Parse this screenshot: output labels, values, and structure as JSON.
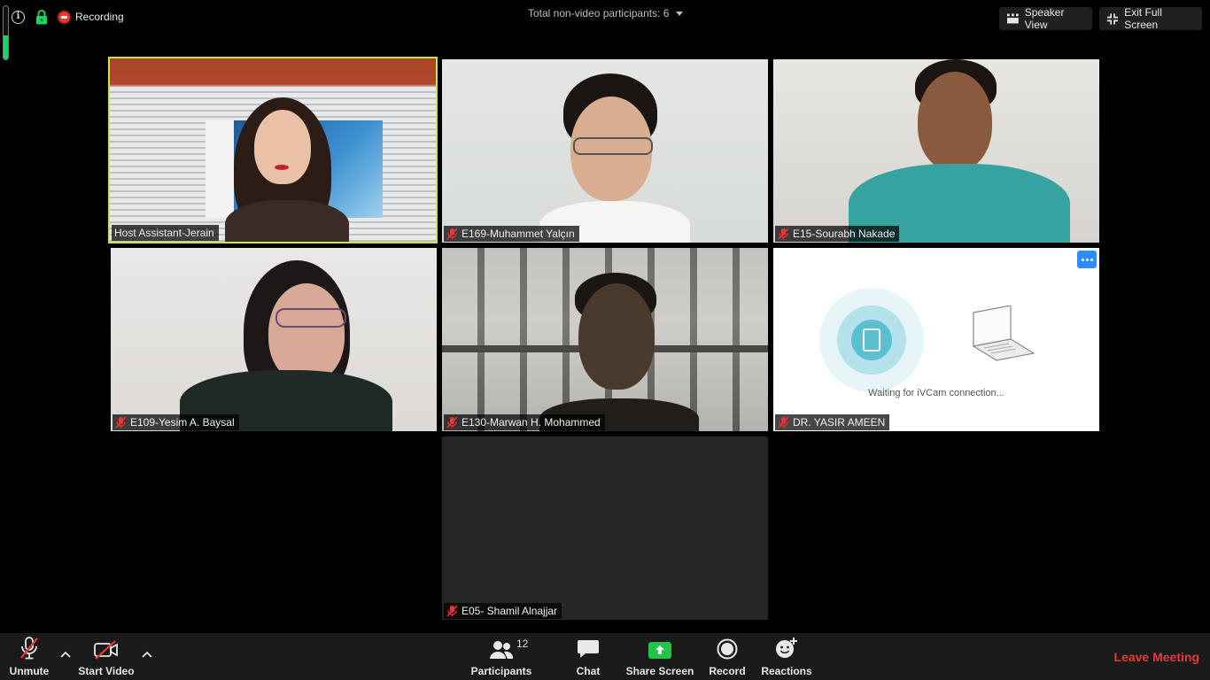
{
  "top_bar": {
    "recording_label": "Recording",
    "nonvideo_label": "Total non-video participants: 6",
    "speaker_view_label": "Speaker View",
    "exit_fullscreen_label": "Exit Full Screen",
    "mic_level": 0.45
  },
  "participants": [
    {
      "name": "Host Assistant-Jerain",
      "muted": false,
      "active_speaker": true
    },
    {
      "name": "E169-Muhammet Yalçın",
      "muted": true,
      "active_speaker": false
    },
    {
      "name": "E15-Sourabh Nakade",
      "muted": true,
      "active_speaker": false
    },
    {
      "name": "E109-Yesim A. Baysal",
      "muted": true,
      "active_speaker": false
    },
    {
      "name": "E130-Marwan H. Mohammed",
      "muted": true,
      "active_speaker": false
    },
    {
      "name": "DR. YASIR AMEEN",
      "muted": true,
      "active_speaker": false,
      "video_text": "Waiting for iVCam connection..."
    },
    {
      "name": "E05- Shamil Alnajjar",
      "muted": true,
      "active_speaker": false
    }
  ],
  "toolbar": {
    "unmute_label": "Unmute",
    "start_video_label": "Start Video",
    "participants_label": "Participants",
    "participants_count": "12",
    "chat_label": "Chat",
    "share_screen_label": "Share Screen",
    "record_label": "Record",
    "reactions_label": "Reactions",
    "leave_label": "Leave Meeting"
  },
  "colors": {
    "active_speaker_border": "#c8e64c",
    "leave_red": "#e53935",
    "share_green": "#23c44a",
    "more_blue": "#2d8cff"
  }
}
